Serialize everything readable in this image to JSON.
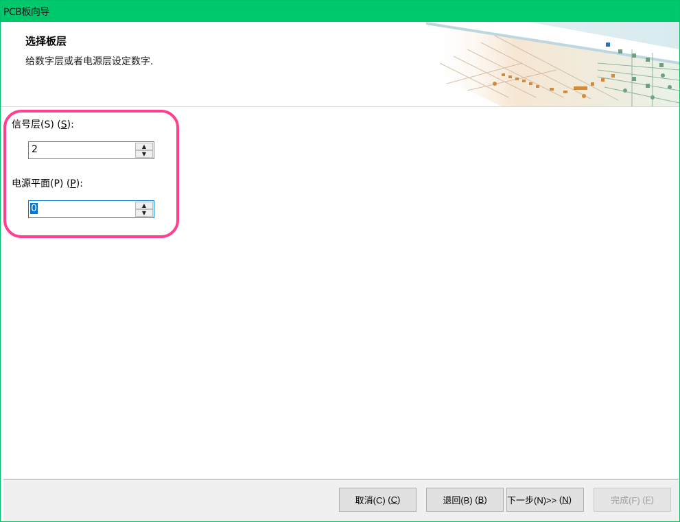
{
  "window": {
    "title": "PCB板向导",
    "accent": "#00c96b"
  },
  "header": {
    "title": "选择板层",
    "subtitle": "给数字层或者电源层设定数字."
  },
  "fields": {
    "signal_layers": {
      "label": "信号层(S)",
      "mnemonic": "S",
      "value": "2"
    },
    "power_planes": {
      "label": "电源平面(P)",
      "mnemonic": "P",
      "value": "0"
    }
  },
  "buttons": {
    "cancel": {
      "label": "取消(C)",
      "mnemonic": "C"
    },
    "back": {
      "label": "退回(B)",
      "mnemonic": "B"
    },
    "next": {
      "label": "下一步(N)>>",
      "mnemonic": "N"
    },
    "finish": {
      "label": "完成(F)",
      "mnemonic": "F"
    }
  },
  "highlight_color": "#ff3f90"
}
